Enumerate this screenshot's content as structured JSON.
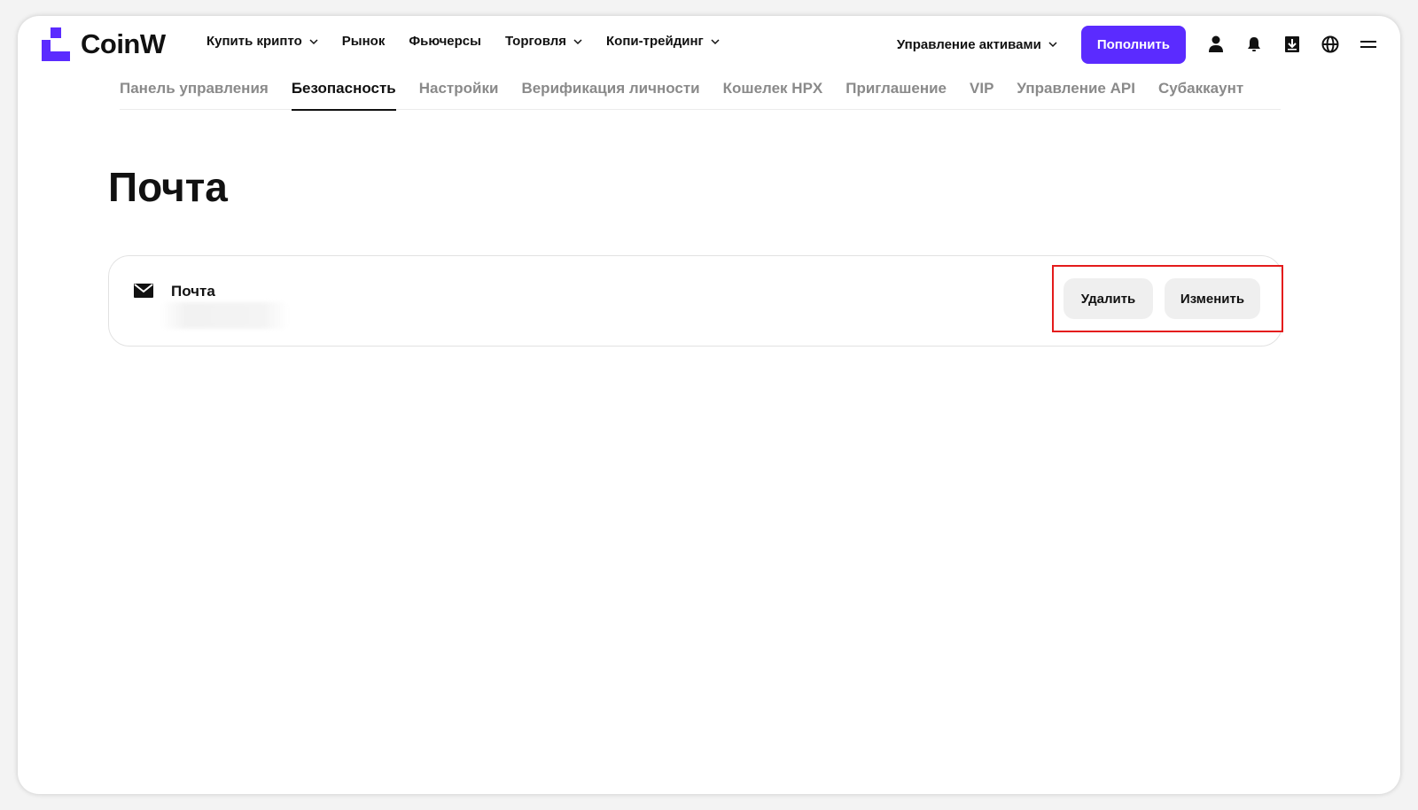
{
  "brand": {
    "name": "CoinW",
    "accent": "#5b2bff"
  },
  "nav": {
    "items": [
      {
        "label": "Купить крипто",
        "dropdown": true
      },
      {
        "label": "Рынок",
        "dropdown": false
      },
      {
        "label": "Фьючерсы",
        "dropdown": false
      },
      {
        "label": "Торговля",
        "dropdown": true
      },
      {
        "label": "Копи-трейдинг",
        "dropdown": true
      }
    ],
    "assets_label": "Управление активами",
    "deposit_label": "Пополнить",
    "icons": [
      "user-icon",
      "bell-icon",
      "download-icon",
      "globe-icon",
      "menu-icon"
    ]
  },
  "tabs": [
    {
      "label": "Панель управления",
      "active": false
    },
    {
      "label": "Безопасность",
      "active": true
    },
    {
      "label": "Настройки",
      "active": false
    },
    {
      "label": "Верификация личности",
      "active": false
    },
    {
      "label": "Кошелек HPX",
      "active": false
    },
    {
      "label": "Приглашение",
      "active": false
    },
    {
      "label": "VIP",
      "active": false
    },
    {
      "label": "Управление API",
      "active": false
    },
    {
      "label": "Субаккаунт",
      "active": false
    }
  ],
  "page": {
    "title": "Почта",
    "card": {
      "label": "Почта",
      "delete_label": "Удалить",
      "edit_label": "Изменить"
    }
  },
  "highlight_color": "#e41b1b"
}
